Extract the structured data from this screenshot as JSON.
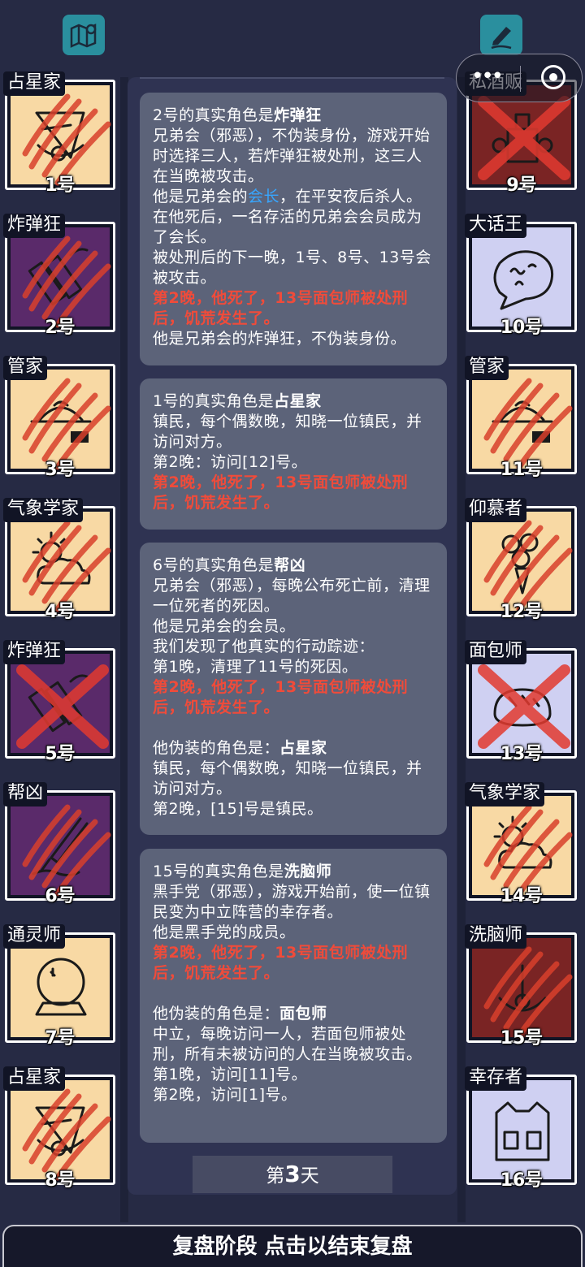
{
  "top": {
    "map_icon": "map-pin-icon",
    "edit_icon": "pen-edit-icon"
  },
  "capsule": {
    "more_icon": "more-dots-icon",
    "close_icon": "target-close-icon"
  },
  "left_cards": [
    {
      "label": "占星家",
      "num": "1号",
      "bg": "#f8d9a4",
      "icon": "sextant-icon",
      "state": "clawed"
    },
    {
      "label": "炸弹狂",
      "num": "2号",
      "bg": "#5a2a6a",
      "icon": "dynamite-icon",
      "state": "clawed"
    },
    {
      "label": "管家",
      "num": "3号",
      "bg": "#f8d9a4",
      "icon": "tray-icon",
      "state": "clawed"
    },
    {
      "label": "气象学家",
      "num": "4号",
      "bg": "#f8d9a4",
      "icon": "weather-icon",
      "state": "clawed"
    },
    {
      "label": "炸弹狂",
      "num": "5号",
      "bg": "#5a2a6a",
      "icon": "dynamite-icon",
      "state": "crossed"
    },
    {
      "label": "帮凶",
      "num": "6号",
      "bg": "#5a2a6a",
      "icon": "knife-icon",
      "state": "clawed"
    },
    {
      "label": "通灵师",
      "num": "7号",
      "bg": "#f8d9a4",
      "icon": "crystal-ball-icon",
      "state": "alive"
    },
    {
      "label": "占星家",
      "num": "8号",
      "bg": "#f8d9a4",
      "icon": "sextant-icon",
      "state": "clawed"
    }
  ],
  "right_cards": [
    {
      "label": "私酒贩",
      "num": "9号",
      "bg": "#7a2424",
      "icon": "bottle-icon",
      "state": "crossed"
    },
    {
      "label": "大话王",
      "num": "10号",
      "bg": "#cfd0f2",
      "icon": "speech-bubble-icon",
      "state": "alive"
    },
    {
      "label": "管家",
      "num": "11号",
      "bg": "#f8d9a4",
      "icon": "tray-icon",
      "state": "clawed"
    },
    {
      "label": "仰慕者",
      "num": "12号",
      "bg": "#f8d9a4",
      "icon": "bouquet-icon",
      "state": "clawed"
    },
    {
      "label": "面包师",
      "num": "13号",
      "bg": "#cfd0f2",
      "icon": "bread-icon",
      "state": "crossed"
    },
    {
      "label": "气象学家",
      "num": "14号",
      "bg": "#f8d9a4",
      "icon": "weather-icon",
      "state": "clawed"
    },
    {
      "label": "洗脑师",
      "num": "15号",
      "bg": "#7a2424",
      "icon": "pendulum-icon",
      "state": "clawed"
    },
    {
      "label": "幸存者",
      "num": "16号",
      "bg": "#cfd0f2",
      "icon": "vest-icon",
      "state": "alive"
    }
  ],
  "entries": [
    {
      "lines": [
        {
          "parts": [
            {
              "t": "2号的真实角色是"
            },
            {
              "t": "炸弹狂",
              "c": "b"
            }
          ]
        },
        {
          "parts": [
            {
              "t": "兄弟会（邪恶），不伪装身份，游戏开始时选择三人，若炸弹狂被处刑，这三人在当晚被攻击。"
            }
          ]
        },
        {
          "parts": [
            {
              "t": "他是兄弟会的"
            },
            {
              "t": "会长",
              "c": "blue"
            },
            {
              "t": "，在平安夜后杀人。在他死后，一名存活的兄弟会会员成为了会长。"
            }
          ]
        },
        {
          "parts": [
            {
              "t": "被处刑后的下一晚，1号、8号、13号会被攻击。"
            }
          ]
        },
        {
          "parts": [
            {
              "t": "第2晚，他死了，13号面包师被处刑后，饥荒发生了。",
              "c": "red"
            }
          ]
        },
        {
          "parts": [
            {
              "t": "他是兄弟会的炸弹狂，不伪装身份。"
            }
          ]
        }
      ]
    },
    {
      "lines": [
        {
          "parts": [
            {
              "t": "1号的真实角色是"
            },
            {
              "t": "占星家",
              "c": "b"
            }
          ]
        },
        {
          "parts": [
            {
              "t": "镇民，每个偶数晚，知晓一位镇民，并访问对方。"
            }
          ]
        },
        {
          "parts": [
            {
              "t": "第2晚：访问[12]号。"
            }
          ]
        },
        {
          "parts": [
            {
              "t": "第2晚，他死了，13号面包师被处刑后，饥荒发生了。",
              "c": "red"
            }
          ]
        }
      ]
    },
    {
      "lines": [
        {
          "parts": [
            {
              "t": "6号的真实角色是"
            },
            {
              "t": "帮凶",
              "c": "b"
            }
          ]
        },
        {
          "parts": [
            {
              "t": "兄弟会（邪恶），每晚公布死亡前，清理一位死者的死因。"
            }
          ]
        },
        {
          "parts": [
            {
              "t": "他是兄弟会的会员。"
            }
          ]
        },
        {
          "parts": [
            {
              "t": "我们发现了他真实的行动踪迹："
            }
          ]
        },
        {
          "parts": [
            {
              "t": "第1晚，清理了11号的死因。"
            }
          ]
        },
        {
          "parts": [
            {
              "t": "第2晚，他死了，13号面包师被处刑后，饥荒发生了。",
              "c": "red"
            }
          ]
        },
        {
          "gap": true
        },
        {
          "parts": [
            {
              "t": "他伪装的角色是："
            },
            {
              "t": "占星家",
              "c": "b"
            }
          ]
        },
        {
          "parts": [
            {
              "t": "镇民，每个偶数晚，知晓一位镇民，并访问对方。"
            }
          ]
        },
        {
          "parts": [
            {
              "t": "第2晚，[15]号是镇民。"
            }
          ]
        }
      ]
    },
    {
      "lines": [
        {
          "parts": [
            {
              "t": "15号的真实角色是"
            },
            {
              "t": "洗脑师",
              "c": "b"
            }
          ]
        },
        {
          "parts": [
            {
              "t": "黑手党（邪恶），游戏开始前，使一位镇民变为中立阵营的幸存者。"
            }
          ]
        },
        {
          "parts": [
            {
              "t": "他是黑手党的成员。"
            }
          ]
        },
        {
          "parts": [
            {
              "t": "第2晚，他死了，13号面包师被处刑后，饥荒发生了。",
              "c": "red"
            }
          ]
        },
        {
          "gap": true
        },
        {
          "parts": [
            {
              "t": "他伪装的角色是："
            },
            {
              "t": "面包师",
              "c": "b"
            }
          ]
        },
        {
          "parts": [
            {
              "t": "中立，每晚访问一人，若面包师被处刑，所有未被访问的人在当晚被攻击。"
            }
          ]
        },
        {
          "parts": [
            {
              "t": "第1晚，访问[11]号。"
            }
          ]
        },
        {
          "parts": [
            {
              "t": "第2晚，访问[1]号。"
            }
          ]
        }
      ]
    }
  ],
  "day": {
    "prefix": "第",
    "number": "3",
    "suffix": "天"
  },
  "bottom_bar": "复盘阶段 点击以结束复盘"
}
